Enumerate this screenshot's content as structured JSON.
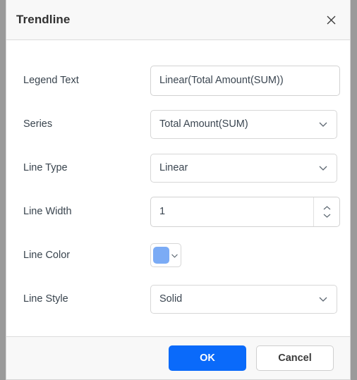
{
  "dialog": {
    "title": "Trendline",
    "close_icon": "close-icon"
  },
  "form": {
    "legend_text": {
      "label": "Legend Text",
      "value": "Linear(Total Amount(SUM))",
      "placeholder": ""
    },
    "series": {
      "label": "Series",
      "value": "Total Amount(SUM)",
      "icon": "chevron-down-icon"
    },
    "line_type": {
      "label": "Line Type",
      "value": "Linear",
      "icon": "chevron-down-icon"
    },
    "line_width": {
      "label": "Line Width",
      "value": "1",
      "icon": "spinner-updown-icon"
    },
    "line_color": {
      "label": "Line Color",
      "value": "#7babf5",
      "icon": "chevron-down-icon"
    },
    "line_style": {
      "label": "Line Style",
      "value": "Solid",
      "icon": "chevron-down-icon"
    }
  },
  "footer": {
    "ok_label": "OK",
    "cancel_label": "Cancel"
  },
  "colors": {
    "primary": "#0a6afa",
    "swatch": "#7babf5",
    "header_bg": "#f8f8f8",
    "label_text": "#39444e"
  }
}
